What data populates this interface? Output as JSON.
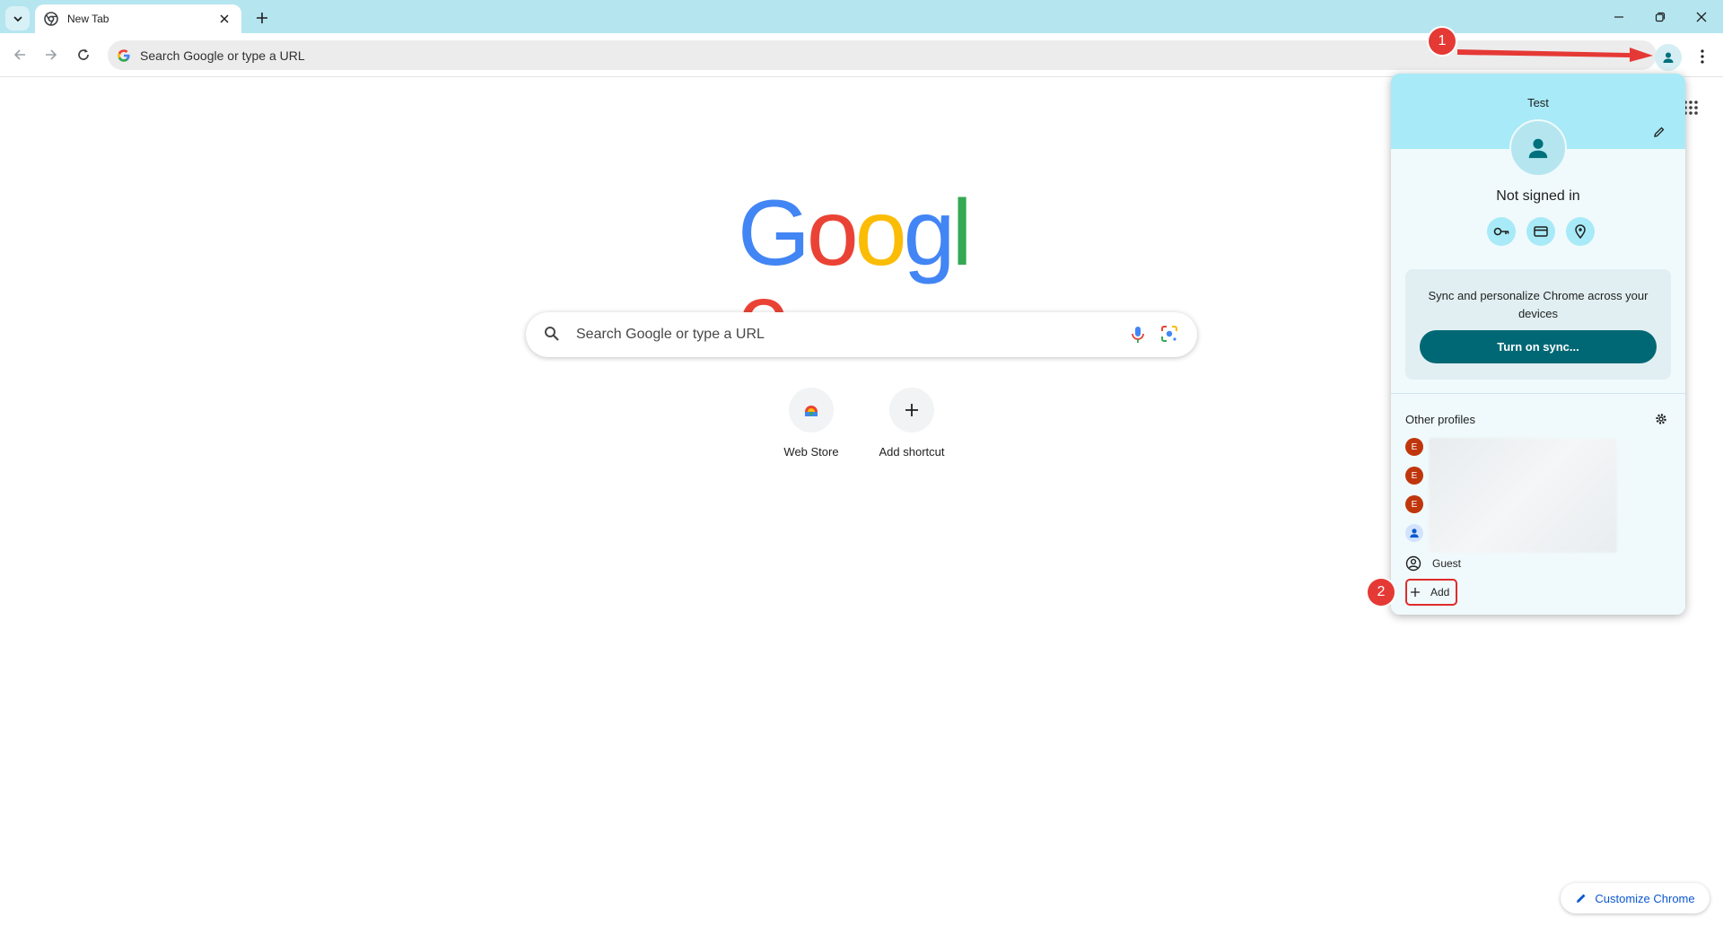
{
  "browser": {
    "tab_title": "New Tab",
    "omnibox_placeholder": "Search Google or type a URL"
  },
  "ntp": {
    "logo_letters": [
      "G",
      "o",
      "o",
      "g",
      "l",
      "e"
    ],
    "logo_colors": [
      "#4285F4",
      "#EA4335",
      "#FBBC05",
      "#4285F4",
      "#34A853",
      "#EA4335"
    ],
    "search_placeholder": "Search Google or type a URL",
    "shortcuts": [
      {
        "label": "Web Store",
        "icon": "web-store-icon"
      },
      {
        "label": "Add shortcut",
        "icon": "plus-icon"
      }
    ],
    "customize_label": "Customize Chrome"
  },
  "profile_menu": {
    "name": "Test",
    "status": "Not signed in",
    "sync_text": "Sync and personalize Chrome across your devices",
    "sync_button": "Turn on sync...",
    "other_profiles_label": "Other profiles",
    "profiles": [
      {
        "initial": "E",
        "type": "letter"
      },
      {
        "initial": "E",
        "type": "letter"
      },
      {
        "initial": "E",
        "type": "letter"
      },
      {
        "initial": "",
        "type": "person"
      }
    ],
    "guest_label": "Guest",
    "add_label": "Add"
  },
  "annotations": [
    "1",
    "2"
  ],
  "colors": {
    "tabstrip": "#b5e6f0",
    "menu_header": "#a8eaf7",
    "sync_button": "#006875",
    "annotation": "#e53935",
    "profile_letter": "#c0360c"
  }
}
